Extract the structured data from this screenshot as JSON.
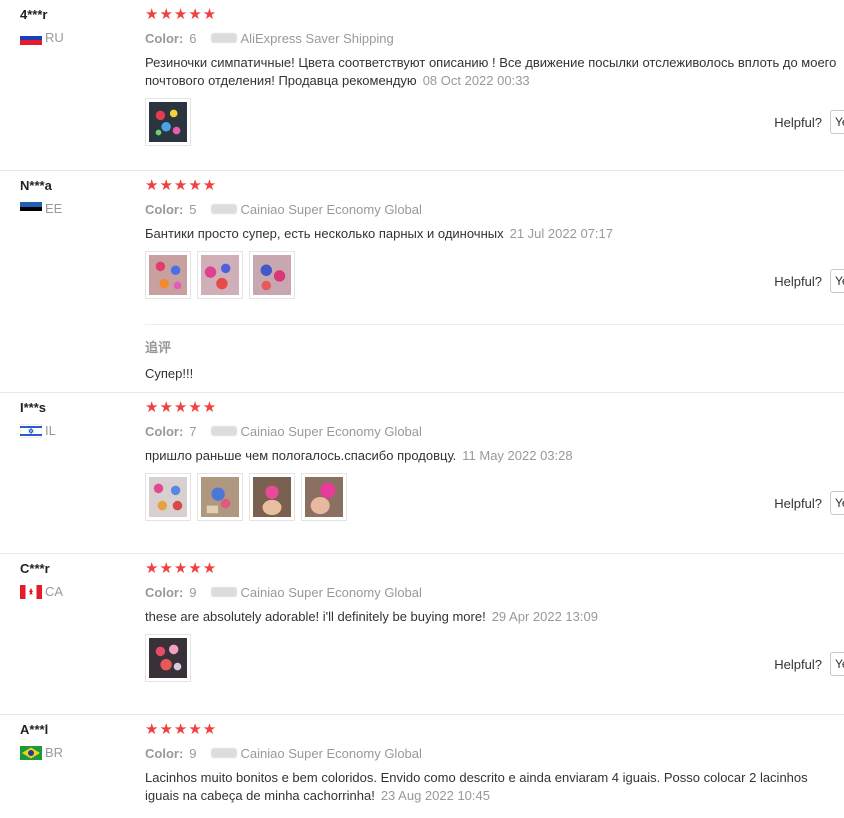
{
  "reviews": [
    {
      "user": "4***r",
      "country": "RU",
      "stars": "★★★★★",
      "color_label": "Color:",
      "color_value": "6",
      "shipping": "AliExpress Saver Shipping",
      "text": "Резиночки симпатичные! Цвета соответствуют описанию ! Все движение посылки отслеживолось вплоть до моего почтового отделения! Продавца рекомендую",
      "date": "08 Oct 2022 00:33",
      "helpful_label": "Helpful?",
      "yes_label": "Yes"
    },
    {
      "user": "N***a",
      "country": "EE",
      "stars": "★★★★★",
      "color_label": "Color:",
      "color_value": "5",
      "shipping": "Cainiao Super Economy Global",
      "text": "Бантики просто супер, есть несколько парных и одиночных",
      "date": "21 Jul 2022 07:17",
      "helpful_label": "Helpful?",
      "yes_label": "Yes",
      "append_title": "追评",
      "append_text": "Супер!!!"
    },
    {
      "user": "I***s",
      "country": "IL",
      "stars": "★★★★★",
      "color_label": "Color:",
      "color_value": "7",
      "shipping": "Cainiao Super Economy Global",
      "text": "пришло раньше чем пологалось.спасибо продовцу.",
      "date": "11 May 2022 03:28",
      "helpful_label": "Helpful?",
      "yes_label": "Yes"
    },
    {
      "user": "C***r",
      "country": "CA",
      "stars": "★★★★★",
      "color_label": "Color:",
      "color_value": "9",
      "shipping": "Cainiao Super Economy Global",
      "text": "these are absolutely adorable! i'll definitely be buying more!",
      "date": "29 Apr 2022 13:09",
      "helpful_label": "Helpful?",
      "yes_label": "Yes"
    },
    {
      "user": "A***l",
      "country": "BR",
      "stars": "★★★★★",
      "color_label": "Color:",
      "color_value": "9",
      "shipping": "Cainiao Super Economy Global",
      "text": "Lacinhos muito bonitos e bem coloridos. Envido como descrito e ainda enviaram 4 iguais. Posso colocar 2 lacinhos iguais na cabeça de minha cachorrinha!",
      "date": "23 Aug 2022 10:45"
    }
  ],
  "colors": {
    "star": "#f04040",
    "muted": "#999999",
    "border": "#e8e8e8"
  }
}
